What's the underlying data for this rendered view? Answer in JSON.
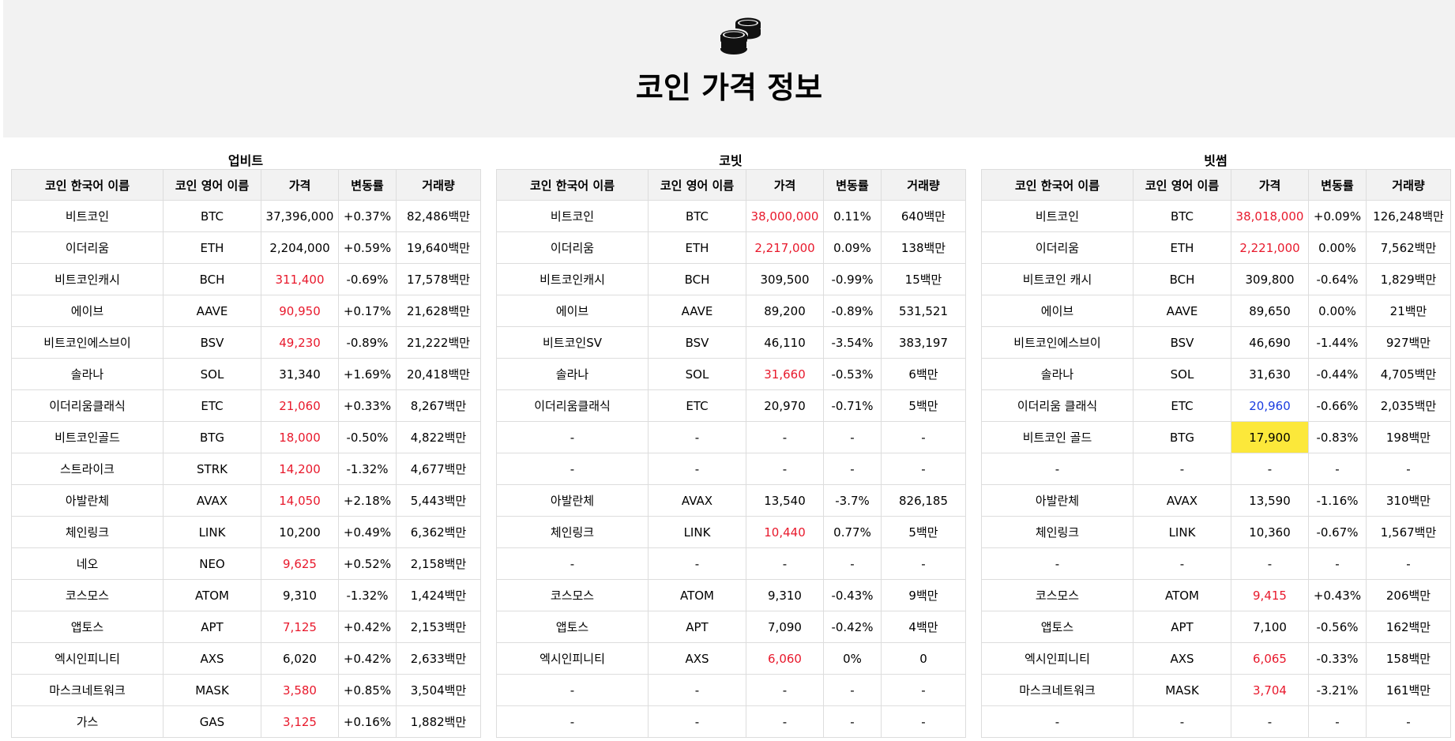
{
  "page": {
    "title": "코인 가격 정보",
    "logo_icon": "coins-stack-icon"
  },
  "columns": [
    "코인 한국어 이름",
    "코인 영어 이름",
    "가격",
    "변동률",
    "거래량"
  ],
  "colors": {
    "up": "#e8192c",
    "down": "#1a3ce0",
    "highlight": "#fce83a",
    "header_bg": "#f2f2f2"
  },
  "exchanges": [
    {
      "name": "업비트",
      "rows": [
        {
          "ko": "비트코인",
          "en": "BTC",
          "price": "37,396,000",
          "change": "+0.37%",
          "volume": "82,486백만",
          "price_color": ""
        },
        {
          "ko": "이더리움",
          "en": "ETH",
          "price": "2,204,000",
          "change": "+0.59%",
          "volume": "19,640백만",
          "price_color": ""
        },
        {
          "ko": "비트코인캐시",
          "en": "BCH",
          "price": "311,400",
          "change": "-0.69%",
          "volume": "17,578백만",
          "price_color": "up"
        },
        {
          "ko": "에이브",
          "en": "AAVE",
          "price": "90,950",
          "change": "+0.17%",
          "volume": "21,628백만",
          "price_color": "up"
        },
        {
          "ko": "비트코인에스브이",
          "en": "BSV",
          "price": "49,230",
          "change": "-0.89%",
          "volume": "21,222백만",
          "price_color": "up"
        },
        {
          "ko": "솔라나",
          "en": "SOL",
          "price": "31,340",
          "change": "+1.69%",
          "volume": "20,418백만",
          "price_color": ""
        },
        {
          "ko": "이더리움클래식",
          "en": "ETC",
          "price": "21,060",
          "change": "+0.33%",
          "volume": "8,267백만",
          "price_color": "up"
        },
        {
          "ko": "비트코인골드",
          "en": "BTG",
          "price": "18,000",
          "change": "-0.50%",
          "volume": "4,822백만",
          "price_color": "up"
        },
        {
          "ko": "스트라이크",
          "en": "STRK",
          "price": "14,200",
          "change": "-1.32%",
          "volume": "4,677백만",
          "price_color": "up"
        },
        {
          "ko": "아발란체",
          "en": "AVAX",
          "price": "14,050",
          "change": "+2.18%",
          "volume": "5,443백만",
          "price_color": "up"
        },
        {
          "ko": "체인링크",
          "en": "LINK",
          "price": "10,200",
          "change": "+0.49%",
          "volume": "6,362백만",
          "price_color": ""
        },
        {
          "ko": "네오",
          "en": "NEO",
          "price": "9,625",
          "change": "+0.52%",
          "volume": "2,158백만",
          "price_color": "up"
        },
        {
          "ko": "코스모스",
          "en": "ATOM",
          "price": "9,310",
          "change": "-1.32%",
          "volume": "1,424백만",
          "price_color": ""
        },
        {
          "ko": "앱토스",
          "en": "APT",
          "price": "7,125",
          "change": "+0.42%",
          "volume": "2,153백만",
          "price_color": "up"
        },
        {
          "ko": "엑시인피니티",
          "en": "AXS",
          "price": "6,020",
          "change": "+0.42%",
          "volume": "2,633백만",
          "price_color": ""
        },
        {
          "ko": "마스크네트워크",
          "en": "MASK",
          "price": "3,580",
          "change": "+0.85%",
          "volume": "3,504백만",
          "price_color": "up"
        },
        {
          "ko": "가스",
          "en": "GAS",
          "price": "3,125",
          "change": "+0.16%",
          "volume": "1,882백만",
          "price_color": "up"
        }
      ]
    },
    {
      "name": "코빗",
      "rows": [
        {
          "ko": "비트코인",
          "en": "BTC",
          "price": "38,000,000",
          "change": "0.11%",
          "volume": "640백만",
          "price_color": "up"
        },
        {
          "ko": "이더리움",
          "en": "ETH",
          "price": "2,217,000",
          "change": "0.09%",
          "volume": "138백만",
          "price_color": "up"
        },
        {
          "ko": "비트코인캐시",
          "en": "BCH",
          "price": "309,500",
          "change": "-0.99%",
          "volume": "15백만",
          "price_color": ""
        },
        {
          "ko": "에이브",
          "en": "AAVE",
          "price": "89,200",
          "change": "-0.89%",
          "volume": "531,521",
          "price_color": ""
        },
        {
          "ko": "비트코인SV",
          "en": "BSV",
          "price": "46,110",
          "change": "-3.54%",
          "volume": "383,197",
          "price_color": ""
        },
        {
          "ko": "솔라나",
          "en": "SOL",
          "price": "31,660",
          "change": "-0.53%",
          "volume": "6백만",
          "price_color": "up"
        },
        {
          "ko": "이더리움클래식",
          "en": "ETC",
          "price": "20,970",
          "change": "-0.71%",
          "volume": "5백만",
          "price_color": ""
        },
        {
          "ko": "-",
          "en": "-",
          "price": "-",
          "change": "-",
          "volume": "-",
          "price_color": ""
        },
        {
          "ko": "-",
          "en": "-",
          "price": "-",
          "change": "-",
          "volume": "-",
          "price_color": ""
        },
        {
          "ko": "아발란체",
          "en": "AVAX",
          "price": "13,540",
          "change": "-3.7%",
          "volume": "826,185",
          "price_color": ""
        },
        {
          "ko": "체인링크",
          "en": "LINK",
          "price": "10,440",
          "change": "0.77%",
          "volume": "5백만",
          "price_color": "up"
        },
        {
          "ko": "-",
          "en": "-",
          "price": "-",
          "change": "-",
          "volume": "-",
          "price_color": ""
        },
        {
          "ko": "코스모스",
          "en": "ATOM",
          "price": "9,310",
          "change": "-0.43%",
          "volume": "9백만",
          "price_color": ""
        },
        {
          "ko": "앱토스",
          "en": "APT",
          "price": "7,090",
          "change": "-0.42%",
          "volume": "4백만",
          "price_color": ""
        },
        {
          "ko": "엑시인피니티",
          "en": "AXS",
          "price": "6,060",
          "change": "0%",
          "volume": "0",
          "price_color": "up"
        },
        {
          "ko": "-",
          "en": "-",
          "price": "-",
          "change": "-",
          "volume": "-",
          "price_color": ""
        },
        {
          "ko": "-",
          "en": "-",
          "price": "-",
          "change": "-",
          "volume": "-",
          "price_color": ""
        }
      ]
    },
    {
      "name": "빗썸",
      "rows": [
        {
          "ko": "비트코인",
          "en": "BTC",
          "price": "38,018,000",
          "change": "+0.09%",
          "volume": "126,248백만",
          "price_color": "up"
        },
        {
          "ko": "이더리움",
          "en": "ETH",
          "price": "2,221,000",
          "change": "0.00%",
          "volume": "7,562백만",
          "price_color": "up"
        },
        {
          "ko": "비트코인 캐시",
          "en": "BCH",
          "price": "309,800",
          "change": "-0.64%",
          "volume": "1,829백만",
          "price_color": ""
        },
        {
          "ko": "에이브",
          "en": "AAVE",
          "price": "89,650",
          "change": "0.00%",
          "volume": "21백만",
          "price_color": ""
        },
        {
          "ko": "비트코인에스브이",
          "en": "BSV",
          "price": "46,690",
          "change": "-1.44%",
          "volume": "927백만",
          "price_color": ""
        },
        {
          "ko": "솔라나",
          "en": "SOL",
          "price": "31,630",
          "change": "-0.44%",
          "volume": "4,705백만",
          "price_color": ""
        },
        {
          "ko": "이더리움 클래식",
          "en": "ETC",
          "price": "20,960",
          "change": "-0.66%",
          "volume": "2,035백만",
          "price_color": "down"
        },
        {
          "ko": "비트코인 골드",
          "en": "BTG",
          "price": "17,900",
          "change": "-0.83%",
          "volume": "198백만",
          "price_color": "hl"
        },
        {
          "ko": "-",
          "en": "-",
          "price": "-",
          "change": "-",
          "volume": "-",
          "price_color": ""
        },
        {
          "ko": "아발란체",
          "en": "AVAX",
          "price": "13,590",
          "change": "-1.16%",
          "volume": "310백만",
          "price_color": ""
        },
        {
          "ko": "체인링크",
          "en": "LINK",
          "price": "10,360",
          "change": "-0.67%",
          "volume": "1,567백만",
          "price_color": ""
        },
        {
          "ko": "-",
          "en": "-",
          "price": "-",
          "change": "-",
          "volume": "-",
          "price_color": ""
        },
        {
          "ko": "코스모스",
          "en": "ATOM",
          "price": "9,415",
          "change": "+0.43%",
          "volume": "206백만",
          "price_color": "up"
        },
        {
          "ko": "앱토스",
          "en": "APT",
          "price": "7,100",
          "change": "-0.56%",
          "volume": "162백만",
          "price_color": ""
        },
        {
          "ko": "엑시인피니티",
          "en": "AXS",
          "price": "6,065",
          "change": "-0.33%",
          "volume": "158백만",
          "price_color": "up"
        },
        {
          "ko": "마스크네트워크",
          "en": "MASK",
          "price": "3,704",
          "change": "-3.21%",
          "volume": "161백만",
          "price_color": "up"
        },
        {
          "ko": "-",
          "en": "-",
          "price": "-",
          "change": "-",
          "volume": "-",
          "price_color": ""
        }
      ]
    }
  ]
}
